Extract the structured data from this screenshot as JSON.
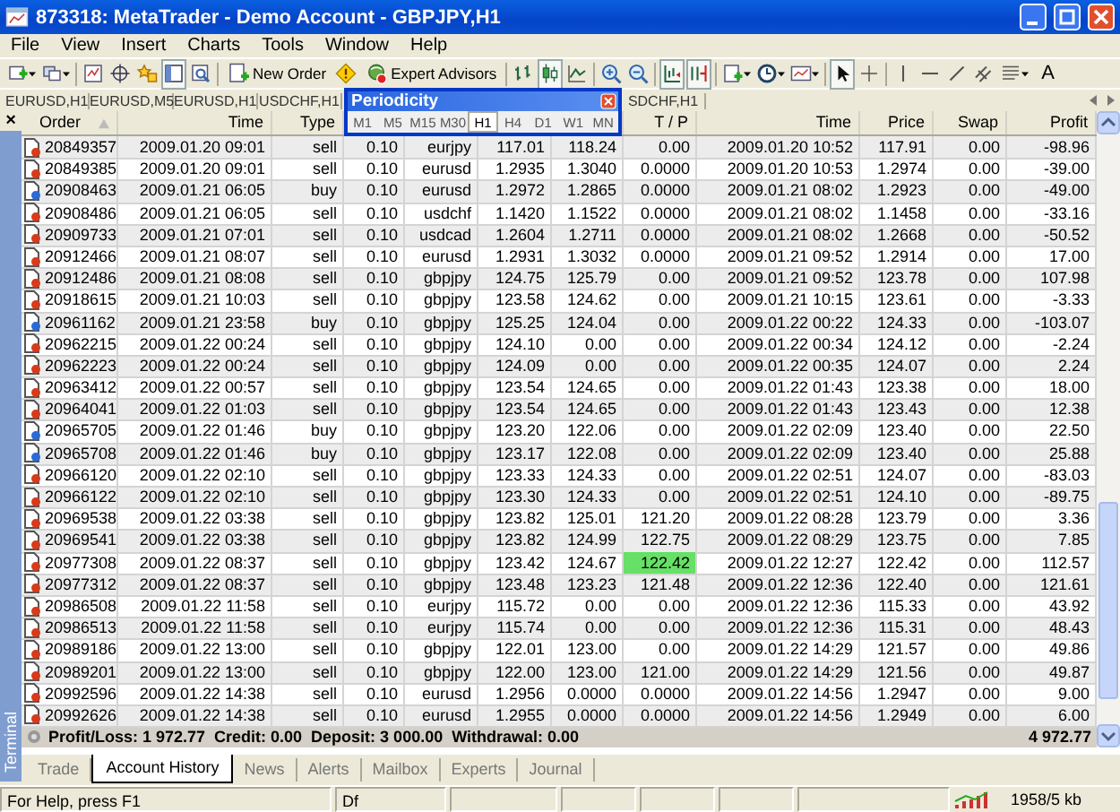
{
  "window": {
    "title": "873318: MetaTrader - Demo Account - GBPJPY,H1"
  },
  "menu": [
    "File",
    "View",
    "Insert",
    "Charts",
    "Tools",
    "Window",
    "Help"
  ],
  "toolbar": {
    "buttons": [
      "New Order",
      "Expert Advisors"
    ],
    "text_tool": "A"
  },
  "chart_tabs": [
    "EURUSD,H1",
    "EURUSD,M5",
    "EURUSD,H1",
    "USDCHF,H1",
    "SDCHF,H1"
  ],
  "periodicity": {
    "title": "Periodicity",
    "periods": [
      {
        "label": "M1",
        "selected": false
      },
      {
        "label": "M5",
        "selected": false
      },
      {
        "label": "M15",
        "selected": false
      },
      {
        "label": "M30",
        "selected": false
      },
      {
        "label": "H1",
        "selected": true
      },
      {
        "label": "H4",
        "selected": false
      },
      {
        "label": "D1",
        "selected": false
      },
      {
        "label": "W1",
        "selected": false
      },
      {
        "label": "MN",
        "selected": false
      }
    ]
  },
  "terminal": {
    "label": "Terminal",
    "close": "×",
    "columns_left": [
      "Order",
      "Time",
      "Type"
    ],
    "columns_right": [
      "T / P",
      "Time",
      "Price",
      "Swap",
      "Profit"
    ],
    "rows": [
      {
        "kind": "sell",
        "order": "20849357",
        "open_time": "2009.01.20 09:01",
        "type": "sell",
        "size": "0.10",
        "symbol": "eurjpy",
        "open_price": "117.01",
        "sl": "118.24",
        "tp": "0.00",
        "tp_highlighted": false,
        "close_time": "2009.01.20 10:52",
        "close_price": "117.91",
        "swap": "0.00",
        "profit": "-98.96"
      },
      {
        "kind": "sell",
        "order": "20849385",
        "open_time": "2009.01.20 09:01",
        "type": "sell",
        "size": "0.10",
        "symbol": "eurusd",
        "open_price": "1.2935",
        "sl": "1.3040",
        "tp": "0.0000",
        "tp_highlighted": false,
        "close_time": "2009.01.20 10:53",
        "close_price": "1.2974",
        "swap": "0.00",
        "profit": "-39.00"
      },
      {
        "kind": "buy",
        "order": "20908463",
        "open_time": "2009.01.21 06:05",
        "type": "buy",
        "size": "0.10",
        "symbol": "eurusd",
        "open_price": "1.2972",
        "sl": "1.2865",
        "tp": "0.0000",
        "tp_highlighted": false,
        "close_time": "2009.01.21 08:02",
        "close_price": "1.2923",
        "swap": "0.00",
        "profit": "-49.00"
      },
      {
        "kind": "sell",
        "order": "20908486",
        "open_time": "2009.01.21 06:05",
        "type": "sell",
        "size": "0.10",
        "symbol": "usdchf",
        "open_price": "1.1420",
        "sl": "1.1522",
        "tp": "0.0000",
        "tp_highlighted": false,
        "close_time": "2009.01.21 08:02",
        "close_price": "1.1458",
        "swap": "0.00",
        "profit": "-33.16"
      },
      {
        "kind": "sell",
        "order": "20909733",
        "open_time": "2009.01.21 07:01",
        "type": "sell",
        "size": "0.10",
        "symbol": "usdcad",
        "open_price": "1.2604",
        "sl": "1.2711",
        "tp": "0.0000",
        "tp_highlighted": false,
        "close_time": "2009.01.21 08:02",
        "close_price": "1.2668",
        "swap": "0.00",
        "profit": "-50.52"
      },
      {
        "kind": "sell",
        "order": "20912466",
        "open_time": "2009.01.21 08:07",
        "type": "sell",
        "size": "0.10",
        "symbol": "eurusd",
        "open_price": "1.2931",
        "sl": "1.3032",
        "tp": "0.0000",
        "tp_highlighted": false,
        "close_time": "2009.01.21 09:52",
        "close_price": "1.2914",
        "swap": "0.00",
        "profit": "17.00"
      },
      {
        "kind": "sell",
        "order": "20912486",
        "open_time": "2009.01.21 08:08",
        "type": "sell",
        "size": "0.10",
        "symbol": "gbpjpy",
        "open_price": "124.75",
        "sl": "125.79",
        "tp": "0.00",
        "tp_highlighted": false,
        "close_time": "2009.01.21 09:52",
        "close_price": "123.78",
        "swap": "0.00",
        "profit": "107.98"
      },
      {
        "kind": "sell",
        "order": "20918615",
        "open_time": "2009.01.21 10:03",
        "type": "sell",
        "size": "0.10",
        "symbol": "gbpjpy",
        "open_price": "123.58",
        "sl": "124.62",
        "tp": "0.00",
        "tp_highlighted": false,
        "close_time": "2009.01.21 10:15",
        "close_price": "123.61",
        "swap": "0.00",
        "profit": "-3.33"
      },
      {
        "kind": "buy",
        "order": "20961162",
        "open_time": "2009.01.21 23:58",
        "type": "buy",
        "size": "0.10",
        "symbol": "gbpjpy",
        "open_price": "125.25",
        "sl": "124.04",
        "tp": "0.00",
        "tp_highlighted": false,
        "close_time": "2009.01.22 00:22",
        "close_price": "124.33",
        "swap": "0.00",
        "profit": "-103.07"
      },
      {
        "kind": "sell",
        "order": "20962215",
        "open_time": "2009.01.22 00:24",
        "type": "sell",
        "size": "0.10",
        "symbol": "gbpjpy",
        "open_price": "124.10",
        "sl": "0.00",
        "tp": "0.00",
        "tp_highlighted": false,
        "close_time": "2009.01.22 00:34",
        "close_price": "124.12",
        "swap": "0.00",
        "profit": "-2.24"
      },
      {
        "kind": "sell",
        "order": "20962223",
        "open_time": "2009.01.22 00:24",
        "type": "sell",
        "size": "0.10",
        "symbol": "gbpjpy",
        "open_price": "124.09",
        "sl": "0.00",
        "tp": "0.00",
        "tp_highlighted": false,
        "close_time": "2009.01.22 00:35",
        "close_price": "124.07",
        "swap": "0.00",
        "profit": "2.24"
      },
      {
        "kind": "sell",
        "order": "20963412",
        "open_time": "2009.01.22 00:57",
        "type": "sell",
        "size": "0.10",
        "symbol": "gbpjpy",
        "open_price": "123.54",
        "sl": "124.65",
        "tp": "0.00",
        "tp_highlighted": false,
        "close_time": "2009.01.22 01:43",
        "close_price": "123.38",
        "swap": "0.00",
        "profit": "18.00"
      },
      {
        "kind": "sell",
        "order": "20964041",
        "open_time": "2009.01.22 01:03",
        "type": "sell",
        "size": "0.10",
        "symbol": "gbpjpy",
        "open_price": "123.54",
        "sl": "124.65",
        "tp": "0.00",
        "tp_highlighted": false,
        "close_time": "2009.01.22 01:43",
        "close_price": "123.43",
        "swap": "0.00",
        "profit": "12.38"
      },
      {
        "kind": "buy",
        "order": "20965705",
        "open_time": "2009.01.22 01:46",
        "type": "buy",
        "size": "0.10",
        "symbol": "gbpjpy",
        "open_price": "123.20",
        "sl": "122.06",
        "tp": "0.00",
        "tp_highlighted": false,
        "close_time": "2009.01.22 02:09",
        "close_price": "123.40",
        "swap": "0.00",
        "profit": "22.50"
      },
      {
        "kind": "buy",
        "order": "20965708",
        "open_time": "2009.01.22 01:46",
        "type": "buy",
        "size": "0.10",
        "symbol": "gbpjpy",
        "open_price": "123.17",
        "sl": "122.08",
        "tp": "0.00",
        "tp_highlighted": false,
        "close_time": "2009.01.22 02:09",
        "close_price": "123.40",
        "swap": "0.00",
        "profit": "25.88"
      },
      {
        "kind": "sell",
        "order": "20966120",
        "open_time": "2009.01.22 02:10",
        "type": "sell",
        "size": "0.10",
        "symbol": "gbpjpy",
        "open_price": "123.33",
        "sl": "124.33",
        "tp": "0.00",
        "tp_highlighted": false,
        "close_time": "2009.01.22 02:51",
        "close_price": "124.07",
        "swap": "0.00",
        "profit": "-83.03"
      },
      {
        "kind": "sell",
        "order": "20966122",
        "open_time": "2009.01.22 02:10",
        "type": "sell",
        "size": "0.10",
        "symbol": "gbpjpy",
        "open_price": "123.30",
        "sl": "124.33",
        "tp": "0.00",
        "tp_highlighted": false,
        "close_time": "2009.01.22 02:51",
        "close_price": "124.10",
        "swap": "0.00",
        "profit": "-89.75"
      },
      {
        "kind": "sell",
        "order": "20969538",
        "open_time": "2009.01.22 03:38",
        "type": "sell",
        "size": "0.10",
        "symbol": "gbpjpy",
        "open_price": "123.82",
        "sl": "125.01",
        "tp": "121.20",
        "tp_highlighted": false,
        "close_time": "2009.01.22 08:28",
        "close_price": "123.79",
        "swap": "0.00",
        "profit": "3.36"
      },
      {
        "kind": "sell",
        "order": "20969541",
        "open_time": "2009.01.22 03:38",
        "type": "sell",
        "size": "0.10",
        "symbol": "gbpjpy",
        "open_price": "123.82",
        "sl": "124.99",
        "tp": "122.75",
        "tp_highlighted": false,
        "close_time": "2009.01.22 08:29",
        "close_price": "123.75",
        "swap": "0.00",
        "profit": "7.85"
      },
      {
        "kind": "sell",
        "order": "20977308",
        "open_time": "2009.01.22 08:37",
        "type": "sell",
        "size": "0.10",
        "symbol": "gbpjpy",
        "open_price": "123.42",
        "sl": "124.67",
        "tp": "122.42",
        "tp_highlighted": true,
        "close_time": "2009.01.22 12:27",
        "close_price": "122.42",
        "swap": "0.00",
        "profit": "112.57"
      },
      {
        "kind": "sell",
        "order": "20977312",
        "open_time": "2009.01.22 08:37",
        "type": "sell",
        "size": "0.10",
        "symbol": "gbpjpy",
        "open_price": "123.48",
        "sl": "123.23",
        "tp": "121.48",
        "tp_highlighted": false,
        "close_time": "2009.01.22 12:36",
        "close_price": "122.40",
        "swap": "0.00",
        "profit": "121.61"
      },
      {
        "kind": "sell",
        "order": "20986508",
        "open_time": "2009.01.22 11:58",
        "type": "sell",
        "size": "0.10",
        "symbol": "eurjpy",
        "open_price": "115.72",
        "sl": "0.00",
        "tp": "0.00",
        "tp_highlighted": false,
        "close_time": "2009.01.22 12:36",
        "close_price": "115.33",
        "swap": "0.00",
        "profit": "43.92"
      },
      {
        "kind": "sell",
        "order": "20986513",
        "open_time": "2009.01.22 11:58",
        "type": "sell",
        "size": "0.10",
        "symbol": "eurjpy",
        "open_price": "115.74",
        "sl": "0.00",
        "tp": "0.00",
        "tp_highlighted": false,
        "close_time": "2009.01.22 12:36",
        "close_price": "115.31",
        "swap": "0.00",
        "profit": "48.43"
      },
      {
        "kind": "sell",
        "order": "20989186",
        "open_time": "2009.01.22 13:00",
        "type": "sell",
        "size": "0.10",
        "symbol": "gbpjpy",
        "open_price": "122.01",
        "sl": "123.00",
        "tp": "0.00",
        "tp_highlighted": false,
        "close_time": "2009.01.22 14:29",
        "close_price": "121.57",
        "swap": "0.00",
        "profit": "49.86"
      },
      {
        "kind": "sell",
        "order": "20989201",
        "open_time": "2009.01.22 13:00",
        "type": "sell",
        "size": "0.10",
        "symbol": "gbpjpy",
        "open_price": "122.00",
        "sl": "123.00",
        "tp": "121.00",
        "tp_highlighted": false,
        "close_time": "2009.01.22 14:29",
        "close_price": "121.56",
        "swap": "0.00",
        "profit": "49.87"
      },
      {
        "kind": "sell",
        "order": "20992596",
        "open_time": "2009.01.22 14:38",
        "type": "sell",
        "size": "0.10",
        "symbol": "eurusd",
        "open_price": "1.2956",
        "sl": "0.0000",
        "tp": "0.0000",
        "tp_highlighted": false,
        "close_time": "2009.01.22 14:56",
        "close_price": "1.2947",
        "swap": "0.00",
        "profit": "9.00"
      },
      {
        "kind": "sell",
        "order": "20992626",
        "open_time": "2009.01.22 14:38",
        "type": "sell",
        "size": "0.10",
        "symbol": "eurusd",
        "open_price": "1.2955",
        "sl": "0.0000",
        "tp": "0.0000",
        "tp_highlighted": false,
        "close_time": "2009.01.22 14:56",
        "close_price": "1.2949",
        "swap": "0.00",
        "profit": "6.00"
      }
    ],
    "summary": {
      "text": "Profit/Loss: 1 972.77  Credit: 0.00  Deposit: 3 000.00  Withdrawal: 0.00",
      "total": "4 972.77"
    },
    "tabs": [
      {
        "label": "Trade",
        "selected": false
      },
      {
        "label": "Account History",
        "selected": true
      },
      {
        "label": "News",
        "selected": false
      },
      {
        "label": "Alerts",
        "selected": false
      },
      {
        "label": "Mailbox",
        "selected": false
      },
      {
        "label": "Experts",
        "selected": false
      },
      {
        "label": "Journal",
        "selected": false
      }
    ]
  },
  "status_bar": {
    "help": "For Help, press F1",
    "profile": "Df",
    "traffic": "1958/5 kb"
  }
}
